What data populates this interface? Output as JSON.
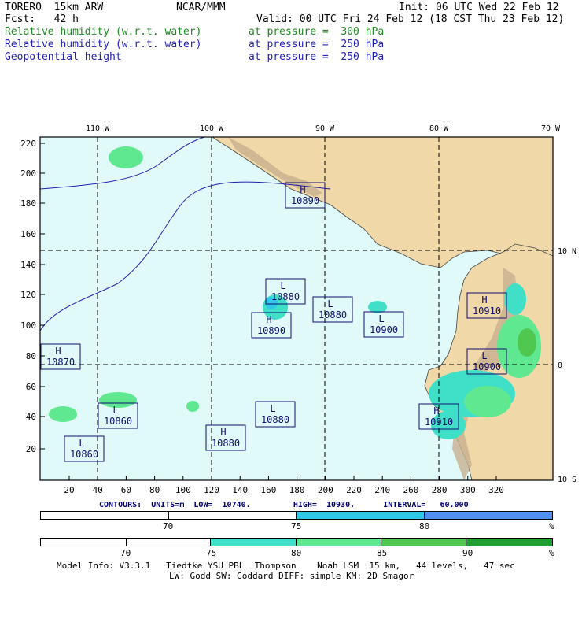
{
  "header": {
    "line1_left": "TORERO  15km ARW",
    "line1_mid": "NCAR/MMM",
    "line1_right": "Init: 06 UTC Wed 22 Feb 12",
    "line2_left": "Fcst:   42 h",
    "line2_right": "Valid: 00 UTC Fri 24 Feb 12 (18 CST Thu 23 Feb 12)",
    "fields": [
      {
        "name": "Relative humidity (w.r.t. water)",
        "level": "at pressure =  300 hPa"
      },
      {
        "name": "Relative humidity (w.r.t. water)",
        "level": "at pressure =  250 hPa"
      },
      {
        "name": "Geopotential height",
        "level": "at pressure =  250 hPa"
      }
    ]
  },
  "map": {
    "top_lon_labels": [
      "110 W",
      "100 W",
      "90 W",
      "80 W",
      "70 W"
    ],
    "right_lat_labels": [
      "10 N",
      "0",
      "10 S"
    ],
    "y_ticks": [
      "220",
      "200",
      "180",
      "160",
      "140",
      "120",
      "100",
      "80",
      "60",
      "40",
      "20"
    ],
    "x_ticks": [
      "20",
      "40",
      "60",
      "80",
      "100",
      "120",
      "140",
      "160",
      "180",
      "200",
      "220",
      "240",
      "260",
      "280",
      "300",
      "320"
    ],
    "centers": [
      {
        "type": "H",
        "value": "10890"
      },
      {
        "type": "L",
        "value": "10880"
      },
      {
        "type": "L",
        "value": "10880"
      },
      {
        "type": "H",
        "value": "10890"
      },
      {
        "type": "L",
        "value": "10900"
      },
      {
        "type": "H",
        "value": "10910"
      },
      {
        "type": "H",
        "value": "10870"
      },
      {
        "type": "L",
        "value": "10900"
      },
      {
        "type": "L",
        "value": "10860"
      },
      {
        "type": "L",
        "value": "10880"
      },
      {
        "type": "H",
        "value": "10910"
      },
      {
        "type": "H",
        "value": "10880"
      },
      {
        "type": "L",
        "value": "10860"
      }
    ]
  },
  "contours_line": "CONTOURS:  UNITS=m  LOW=  10740.         HIGH=  10930.      INTERVAL=   60.000",
  "colorbar1": {
    "labels": [
      "70",
      "75",
      "80"
    ],
    "unit": "%",
    "colors": [
      "#ffffff",
      "#ffffff",
      "#30c8e8",
      "#5090f0"
    ]
  },
  "colorbar2": {
    "labels": [
      "70",
      "75",
      "80",
      "85",
      "90"
    ],
    "unit": "%",
    "colors": [
      "#ffffff",
      "#ffffff",
      "#40e0c8",
      "#60e890",
      "#50c850",
      "#20a030"
    ]
  },
  "footer": {
    "line1": "Model Info: V3.3.1   Tiedtke YSU PBL  Thompson    Noah LSM  15 km,   44 levels,   47 sec",
    "line2": "LW: Godd SW: Goddard DIFF: simple KM: 2D Smagor"
  }
}
